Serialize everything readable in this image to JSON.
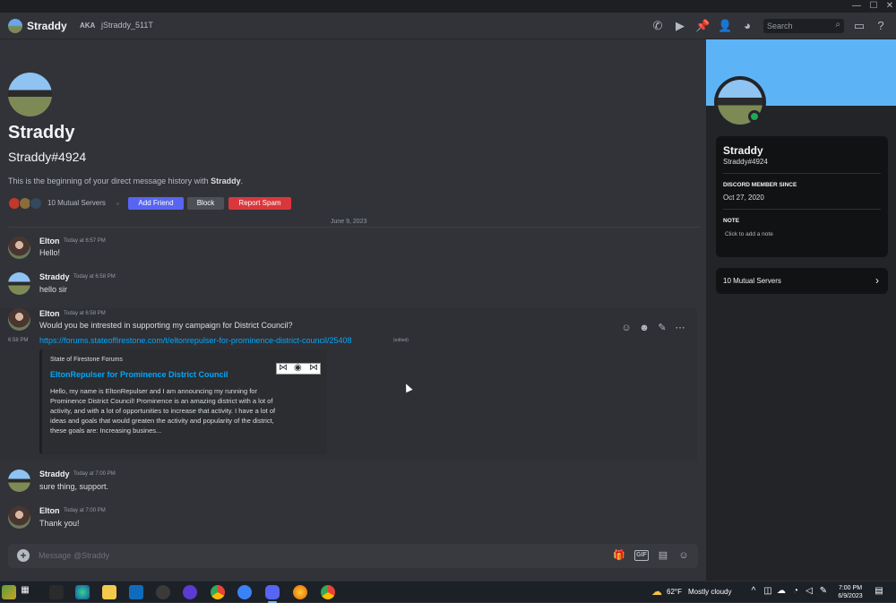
{
  "window": {
    "minimize": "—",
    "maximize": "☐",
    "close": "✕"
  },
  "header": {
    "title": "Straddy",
    "aka_label": "AKA",
    "alias": "jStraddy_511T",
    "search_placeholder": "Search"
  },
  "intro": {
    "name": "Straddy",
    "tag": "Straddy#4924",
    "text_prefix": "This is the beginning of your direct message history with ",
    "text_name": "Straddy",
    "text_suffix": ".",
    "mutual_servers": "10 Mutual Servers",
    "buttons": {
      "add_friend": "Add Friend",
      "block": "Block",
      "report_spam": "Report Spam"
    }
  },
  "date_divider": "June 9, 2023",
  "messages": [
    {
      "author": "Elton",
      "time": "Today at 6:57 PM",
      "text": "Hello!"
    },
    {
      "author": "Straddy",
      "time": "Today at 6:58 PM",
      "text": "hello sir"
    },
    {
      "author": "Elton",
      "time": "Today at 6:58 PM",
      "text": "Would you be intrested in supporting my campaign for District Council?"
    },
    {
      "author": "Straddy",
      "time": "Today at 7:00 PM",
      "text": "sure thing, support."
    },
    {
      "author": "Elton",
      "time": "Today at 7:00 PM",
      "text": "Thank you!"
    }
  ],
  "link_message": {
    "side_time": "6:58 PM",
    "url": "https://forums.stateoffirestone.com/t/eltonrepulser-for-prominence-district-council/25408",
    "edited": "(edited)"
  },
  "embed": {
    "provider": "State of Firestone Forums",
    "title": "EltonRepulser for Prominence District Council",
    "description": "Hello, my name is EltonRepulser and I am announcing my running for Prominence District Council! Prominence is an amazing district with a lot of activity, and with a lot of opportunities to increase that activity. I have a lot of ideas and goals that would greaten the activity and popularity of the district, these goals are: Increasing busines..."
  },
  "composer": {
    "placeholder": "Message @Straddy",
    "gif_label": "GIF"
  },
  "profile": {
    "name": "Straddy",
    "tag": "Straddy#4924",
    "member_since_label": "DISCORD MEMBER SINCE",
    "member_since": "Oct 27, 2020",
    "note_label": "NOTE",
    "note_placeholder": "Click to add a note",
    "mutual_servers": "10 Mutual Servers"
  },
  "taskbar": {
    "temperature": "62°F",
    "condition": "Mostly cloudy",
    "time": "7:00 PM",
    "date": "6/9/2023"
  },
  "colors": {
    "blurple": "#5865f2",
    "red": "#da373c",
    "link": "#00a8fc",
    "online": "#23a55a",
    "banner": "#5cb4f6"
  }
}
